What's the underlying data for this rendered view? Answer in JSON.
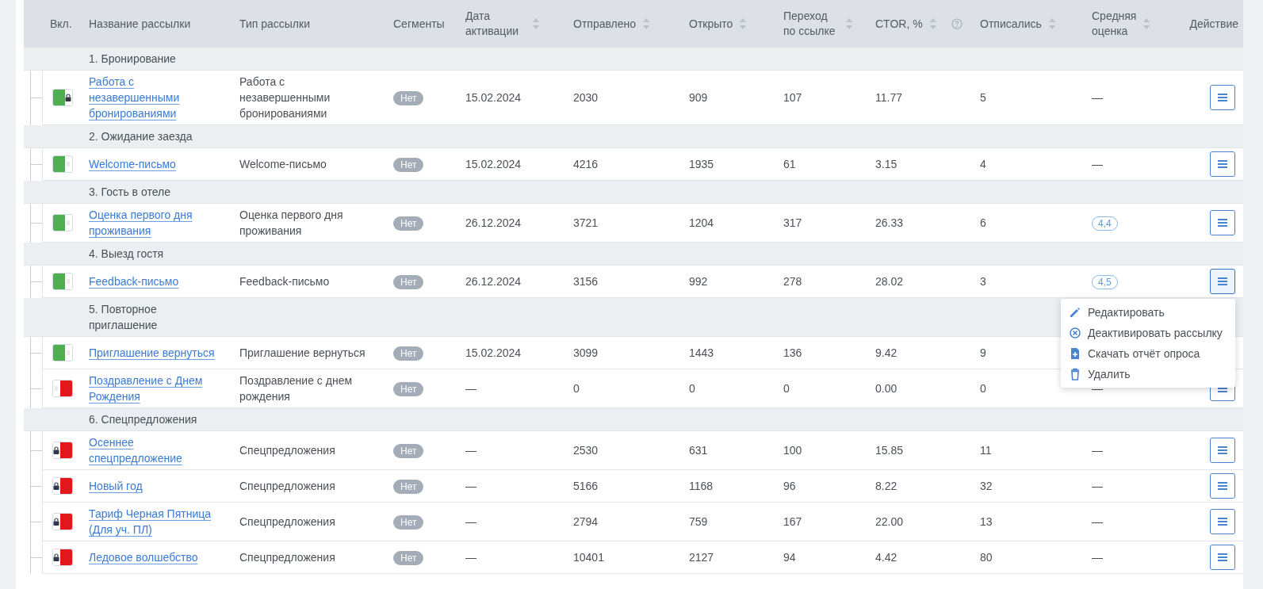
{
  "columns": [
    {
      "label": "Вкл.",
      "sortable": false
    },
    {
      "label": "Название рассылки",
      "sortable": false
    },
    {
      "label": "Тип рассылки",
      "sortable": false
    },
    {
      "label": "Сегменты",
      "sortable": false
    },
    {
      "label": "Дата активации",
      "sortable": true
    },
    {
      "label": "Отправлено",
      "sortable": true
    },
    {
      "label": "Открыто",
      "sortable": true
    },
    {
      "label": "Переход по ссылке",
      "sortable": true
    },
    {
      "label": "CTOR, %",
      "sortable": true,
      "help": true
    },
    {
      "label": "Отписались",
      "sortable": true
    },
    {
      "label": "Средняя оценка",
      "sortable": true
    },
    {
      "label": "Действие",
      "sortable": false
    }
  ],
  "groups": [
    {
      "title": "1. Бронирование",
      "rows": [
        {
          "enabled": true,
          "locked": true,
          "name": "Работа с незавершенными бронированиями",
          "type": "Работа с незавершенными бронированиями",
          "segments": "Нет",
          "date": "15.02.2024",
          "sent": "2030",
          "opened": "909",
          "clicks": "107",
          "ctor": "11.77",
          "unsubscribed": "5",
          "rating": {
            "text": "—",
            "kind": "plain"
          },
          "menu_button": true,
          "menu_open": false
        }
      ]
    },
    {
      "title": "2. Ожидание заезда",
      "rows": [
        {
          "enabled": true,
          "locked": false,
          "name": "Welcome-письмо",
          "type": "Welcome-письмо",
          "segments": "Нет",
          "date": "15.02.2024",
          "sent": "4216",
          "opened": "1935",
          "clicks": "61",
          "ctor": "3.15",
          "unsubscribed": "4",
          "rating": {
            "text": "—",
            "kind": "plain"
          },
          "menu_button": true,
          "menu_open": false
        }
      ]
    },
    {
      "title": "3. Гость в отеле",
      "rows": [
        {
          "enabled": true,
          "locked": false,
          "name": "Оценка первого дня проживания",
          "type": "Оценка первого дня проживания",
          "segments": "Нет",
          "date": "26.12.2024",
          "sent": "3721",
          "opened": "1204",
          "clicks": "317",
          "ctor": "26.33",
          "unsubscribed": "6",
          "rating": {
            "text": "4,4",
            "kind": "badge"
          },
          "menu_button": true,
          "menu_open": false
        }
      ]
    },
    {
      "title": "4. Выезд гостя",
      "rows": [
        {
          "enabled": true,
          "locked": false,
          "name": "Feedback-письмо",
          "type": "Feedback-письмо",
          "segments": "Нет",
          "date": "26.12.2024",
          "sent": "3156",
          "opened": "992",
          "clicks": "278",
          "ctor": "28.02",
          "unsubscribed": "3",
          "rating": {
            "text": "4,5",
            "kind": "badge"
          },
          "menu_button": true,
          "menu_open": true
        }
      ]
    },
    {
      "title": "5. Повторное приглашение",
      "rows": [
        {
          "enabled": true,
          "locked": false,
          "name": "Приглашение вернуться",
          "type": "Приглашение вернуться",
          "segments": "Нет",
          "date": "15.02.2024",
          "sent": "3099",
          "opened": "1443",
          "clicks": "136",
          "ctor": "9.42",
          "unsubscribed": "9",
          "menu_button": false,
          "menu_open": false
        },
        {
          "enabled": false,
          "locked": false,
          "name": "Поздравление с Днем Рождения",
          "type": "Поздравление с днем рождения",
          "segments": "Нет",
          "date": "—",
          "sent": "0",
          "opened": "0",
          "clicks": "0",
          "ctor": "0.00",
          "unsubscribed": "0",
          "rating": {
            "text": "—",
            "kind": "plain"
          },
          "menu_button": true,
          "menu_open": false
        }
      ]
    },
    {
      "title": "6. Спецпредложения",
      "rows": [
        {
          "enabled": false,
          "locked": true,
          "name": "Осеннее спецпредложение",
          "type": "Спецпредложения",
          "segments": "Нет",
          "date": "—",
          "sent": "2530",
          "opened": "631",
          "clicks": "100",
          "ctor": "15.85",
          "unsubscribed": "11",
          "rating": {
            "text": "—",
            "kind": "plain"
          },
          "menu_button": true,
          "menu_open": false
        },
        {
          "enabled": false,
          "locked": true,
          "name": "Новый год",
          "type": "Спецпредложения",
          "segments": "Нет",
          "date": "—",
          "sent": "5166",
          "opened": "1168",
          "clicks": "96",
          "ctor": "8.22",
          "unsubscribed": "32",
          "rating": {
            "text": "—",
            "kind": "plain"
          },
          "menu_button": true,
          "menu_open": false
        },
        {
          "enabled": false,
          "locked": true,
          "name": "Тариф Черная Пятница (Для уч. ПЛ)",
          "type": "Спецпредложения",
          "segments": "Нет",
          "date": "—",
          "sent": "2794",
          "opened": "759",
          "clicks": "167",
          "ctor": "22.00",
          "unsubscribed": "13",
          "rating": {
            "text": "—",
            "kind": "plain"
          },
          "menu_button": true,
          "menu_open": false
        },
        {
          "enabled": false,
          "locked": true,
          "name": "Ледовое волшебство",
          "type": "Спецпредложения",
          "segments": "Нет",
          "date": "—",
          "sent": "10401",
          "opened": "2127",
          "clicks": "94",
          "ctor": "4.42",
          "unsubscribed": "80",
          "rating": {
            "text": "—",
            "kind": "plain"
          },
          "menu_button": true,
          "menu_open": false
        }
      ]
    }
  ],
  "menu": {
    "items": [
      {
        "kind": "edit",
        "label": "Редактировать"
      },
      {
        "kind": "deactivate",
        "label": "Деактивировать рассылку"
      },
      {
        "kind": "download",
        "label": "Скачать отчёт опроса"
      },
      {
        "kind": "delete",
        "label": "Удалить"
      }
    ]
  }
}
